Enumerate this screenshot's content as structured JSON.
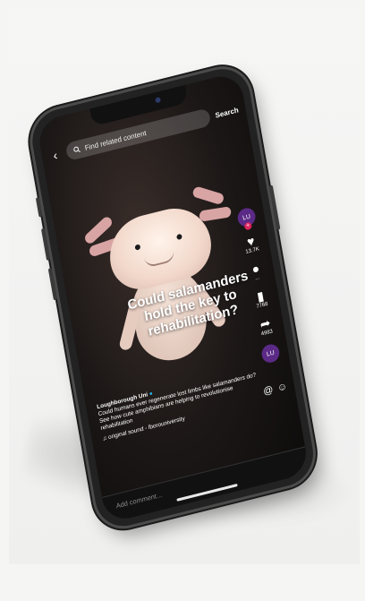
{
  "search": {
    "placeholder": "Find related content",
    "button_label": "Search"
  },
  "video": {
    "caption": "Could salamanders hold the key to rehabilitation?",
    "author": "Loughborough Uni",
    "description": "Could humans ever regenerate lost limbs like salamanders do? See how cute amphibians are helping to revolutionise rehabilitation",
    "sound": "original sound - lborouniversity"
  },
  "rail": {
    "profile_initials": "LU",
    "likes_count": "13.7K",
    "comments_count": "...",
    "bookmarks_count": "7768",
    "shares_count": "4983"
  },
  "comment_bar": {
    "placeholder": "Add comment..."
  },
  "colors": {
    "brand_purple": "#5b2a86",
    "verified_blue": "#20b8ee",
    "follow_pink": "#e0245e"
  },
  "icons": [
    "back-icon",
    "search-icon",
    "heart-icon",
    "comment-icon",
    "bookmark-icon",
    "share-icon",
    "music-note-icon",
    "mention-icon",
    "emoji-icon"
  ]
}
